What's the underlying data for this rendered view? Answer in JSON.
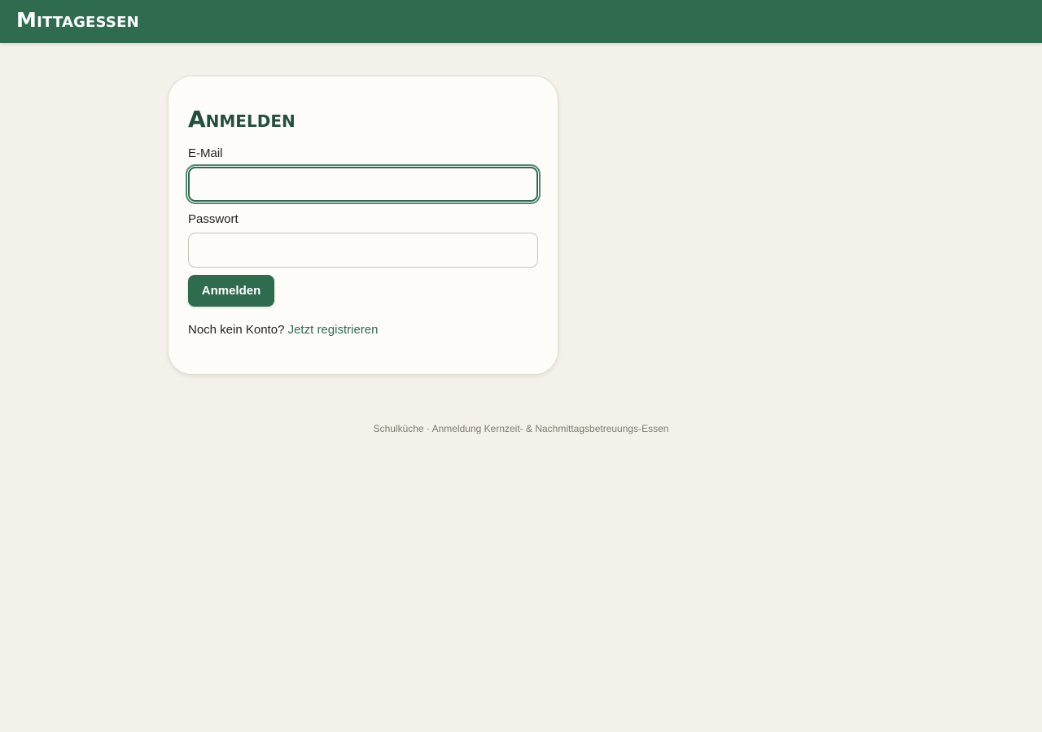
{
  "header": {
    "brand": "Mittagessen"
  },
  "login": {
    "title": "Anmelden",
    "email_label": "E-Mail",
    "email_value": "",
    "password_label": "Passwort",
    "password_value": "",
    "submit_label": "Anmelden",
    "no_account_text": "Noch kein Konto?",
    "register_link": "Jetzt registrieren"
  },
  "footer": {
    "text": "Schulküche · Anmeldung Kernzeit- & Nachmittagsbetreuungs-Essen"
  },
  "colors": {
    "primary": "#2e6b4f",
    "background": "#f4f1ea",
    "card": "#fdfcf8"
  }
}
